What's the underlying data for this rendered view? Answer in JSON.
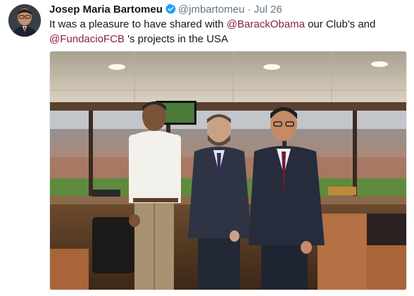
{
  "tweet": {
    "author_name": "Josep Maria Bartomeu",
    "handle": "@jmbartomeu",
    "separator": "·",
    "date": "Jul 26",
    "text_1": "It was a pleasure to have shared with ",
    "mention_1": "@BarackObama",
    "text_2": " our Club's and ",
    "mention_2": "@FundacioFCB",
    "text_3": " 's projects in the USA"
  },
  "icons": {
    "verified": "verified-badge-icon",
    "avatar": "profile-photo"
  },
  "colors": {
    "mention": "#8b1f3e",
    "verified": "#1da1f2",
    "muted": "#657786",
    "text": "#14171a"
  }
}
